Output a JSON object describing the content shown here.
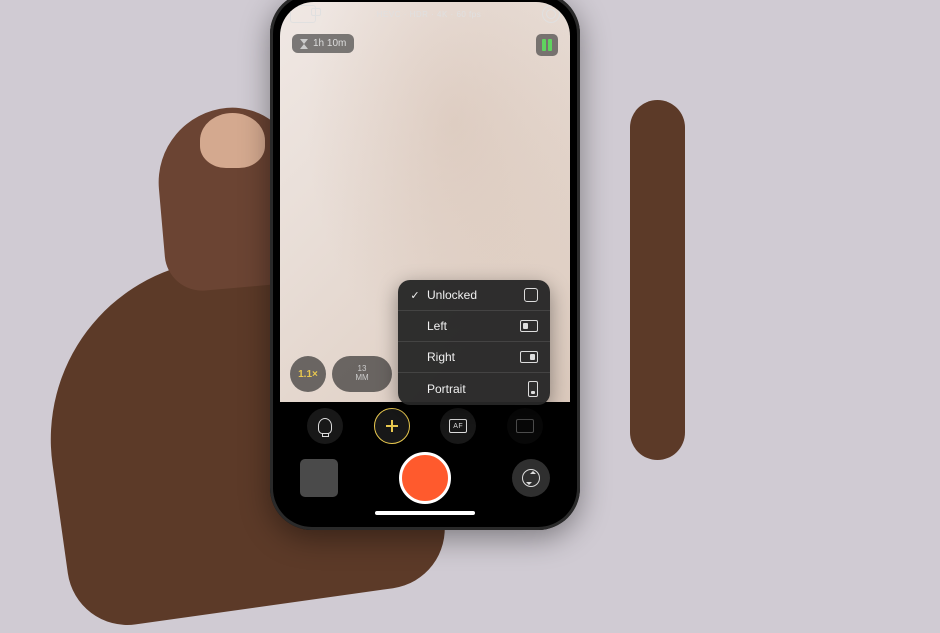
{
  "topBar": {
    "infoText": "HEVC · HDR · 4K · 60 fps"
  },
  "timeChip": {
    "label": "1h 10m"
  },
  "zoom": {
    "value": "1.1×"
  },
  "lens": {
    "upper": "13",
    "lower": "MM"
  },
  "orientationMenu": {
    "items": [
      {
        "label": "Unlocked",
        "checked": true,
        "iconClass": "unlocked"
      },
      {
        "label": "Left",
        "checked": false,
        "iconClass": "left"
      },
      {
        "label": "Right",
        "checked": false,
        "iconClass": "right"
      },
      {
        "label": "Portrait",
        "checked": false,
        "iconClass": "portrait"
      }
    ]
  },
  "tools": {
    "afLabel": "AF"
  }
}
